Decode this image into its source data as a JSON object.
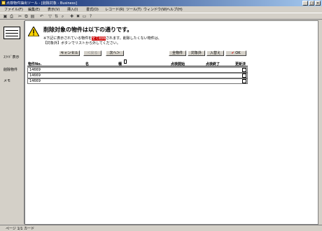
{
  "window": {
    "title": "点検物件抽出ツール - [削除対象 - Business]"
  },
  "menu": [
    "ファイル(F)",
    "編集(E)",
    "表示(V)",
    "挿入(I)",
    "書式(O)",
    "レコード(R)",
    "ツール(T)",
    "ウィンドウ(W)",
    "ヘルプ(H)"
  ],
  "sidebar": {
    "labels": [
      "ｽﾗｲﾄﾞ表示",
      "削除物件",
      "メモ"
    ]
  },
  "dialog": {
    "heading": "削除対象の物件は以下の通りです。",
    "note1_prefix": "※下記に表示されている物件を",
    "note1_highlight": "全て削除",
    "note1_suffix": "されます。削除したくない物件は、",
    "note2": "【対象外】ボタンでリストから外してください。",
    "buttons": {
      "cancel": "キャンセル",
      "back": "＜戻る",
      "next": "次へ＞",
      "all": "全物件",
      "target": "対象外",
      "reselect": "入替え",
      "exec": "OK",
      "check": "✔"
    },
    "columns": {
      "code": "物件No.",
      "name": "名",
      "type": "種",
      "start": "点検開始",
      "end": "点検終了",
      "flag": "更新済"
    },
    "rows": [
      {
        "code": "14669"
      },
      {
        "code": "14669"
      },
      {
        "code": "14669"
      }
    ]
  },
  "status": {
    "text": "ページ 1/1   カード"
  },
  "colors": {
    "title_start": "#0a246a",
    "title_end": "#a6caf0",
    "highlight": "#cc0000"
  }
}
